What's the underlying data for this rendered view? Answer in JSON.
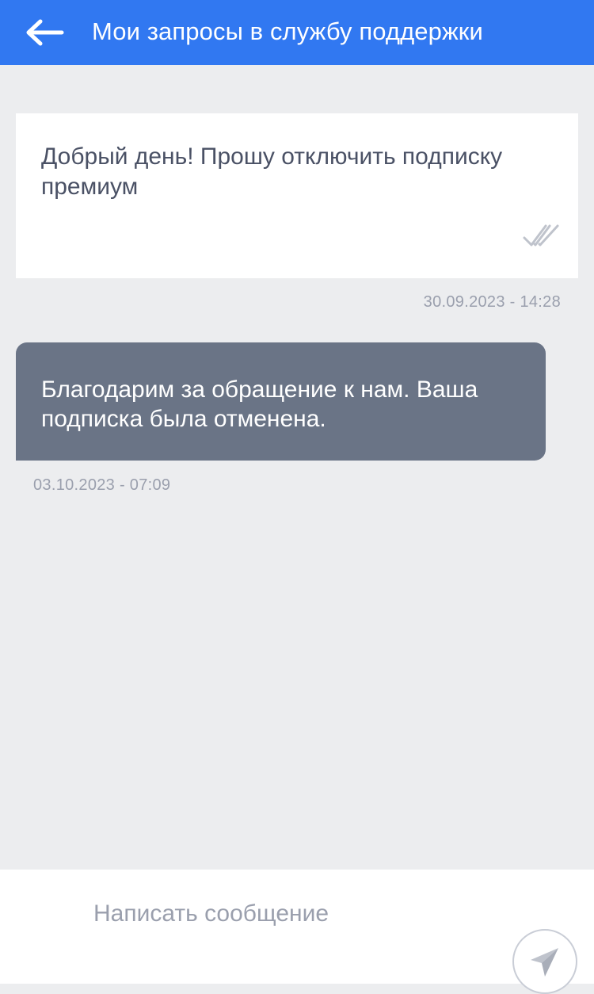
{
  "header": {
    "title": "Мои запросы в службу поддержки",
    "back_icon": "arrow-left-icon"
  },
  "colors": {
    "header_bg": "#3178F1",
    "page_bg": "#ECEDEF",
    "incoming_bubble": "#6A7486",
    "outgoing_bubble": "#FFFFFF",
    "timestamp": "#9A9FAD"
  },
  "messages": [
    {
      "direction": "outgoing",
      "text": "Добрый день! Прошу отключить подписку премиум",
      "timestamp": "30.09.2023 - 14:28",
      "status_icon": "double-check-icon"
    },
    {
      "direction": "incoming",
      "text": "Благодарим за обращение к нам. Ваша подписка была отменена.",
      "timestamp": "03.10.2023 - 07:09"
    }
  ],
  "composer": {
    "placeholder": "Написать сообщение",
    "value": "",
    "send_icon": "send-icon"
  }
}
